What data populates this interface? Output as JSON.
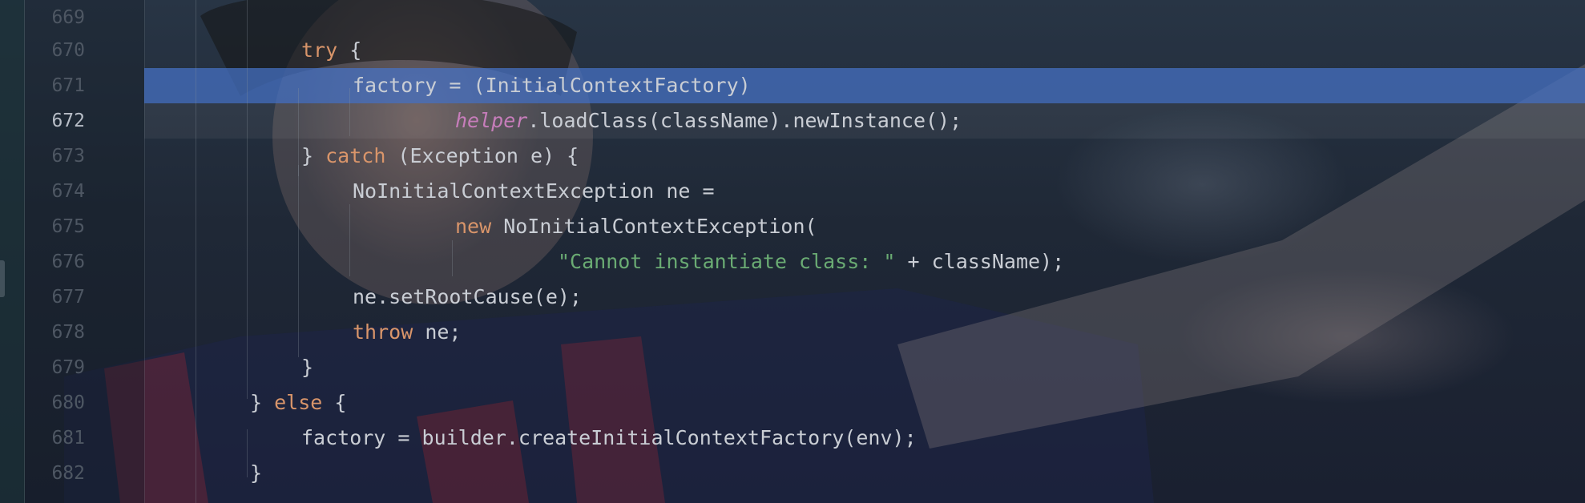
{
  "editor": {
    "accent_selection": "#4673c8",
    "keyword_color": "#d9956a",
    "string_color": "#6aab73",
    "field_color": "#c77dbb",
    "lines": [
      {
        "number": "669",
        "tokens": []
      },
      {
        "number": "670",
        "tokens": [
          {
            "t": "try",
            "c": "kw"
          },
          {
            "t": " {",
            "c": "plain"
          }
        ]
      },
      {
        "number": "671",
        "tokens": [
          {
            "t": "factory = (InitialContextFactory)",
            "c": "plain"
          }
        ]
      },
      {
        "number": "672",
        "tokens": [
          {
            "t": "helper",
            "c": "field"
          },
          {
            "t": ".loadClass(className).newInstance();",
            "c": "plain"
          }
        ]
      },
      {
        "number": "673",
        "tokens": [
          {
            "t": "} ",
            "c": "plain"
          },
          {
            "t": "catch",
            "c": "kw"
          },
          {
            "t": " (Exception e) {",
            "c": "plain"
          }
        ]
      },
      {
        "number": "674",
        "tokens": [
          {
            "t": "NoInitialContextException ne =",
            "c": "plain"
          }
        ]
      },
      {
        "number": "675",
        "tokens": [
          {
            "t": "new",
            "c": "kw"
          },
          {
            "t": " NoInitialContextException(",
            "c": "plain"
          }
        ]
      },
      {
        "number": "676",
        "tokens": [
          {
            "t": "\"Cannot instantiate class: \"",
            "c": "str"
          },
          {
            "t": " + className);",
            "c": "plain"
          }
        ]
      },
      {
        "number": "677",
        "tokens": [
          {
            "t": "ne.setRootCause(e);",
            "c": "plain"
          }
        ]
      },
      {
        "number": "678",
        "tokens": [
          {
            "t": "throw",
            "c": "kw"
          },
          {
            "t": " ne;",
            "c": "plain"
          }
        ]
      },
      {
        "number": "679",
        "tokens": [
          {
            "t": "}",
            "c": "plain"
          }
        ]
      },
      {
        "number": "680",
        "tokens": [
          {
            "t": "} ",
            "c": "plain"
          },
          {
            "t": "else",
            "c": "kw"
          },
          {
            "t": " {",
            "c": "plain"
          }
        ]
      },
      {
        "number": "681",
        "tokens": [
          {
            "t": "factory = builder.createInitialContextFactory(env);",
            "c": "plain"
          }
        ]
      },
      {
        "number": "682",
        "tokens": [
          {
            "t": "}",
            "c": "plain"
          }
        ]
      }
    ]
  }
}
